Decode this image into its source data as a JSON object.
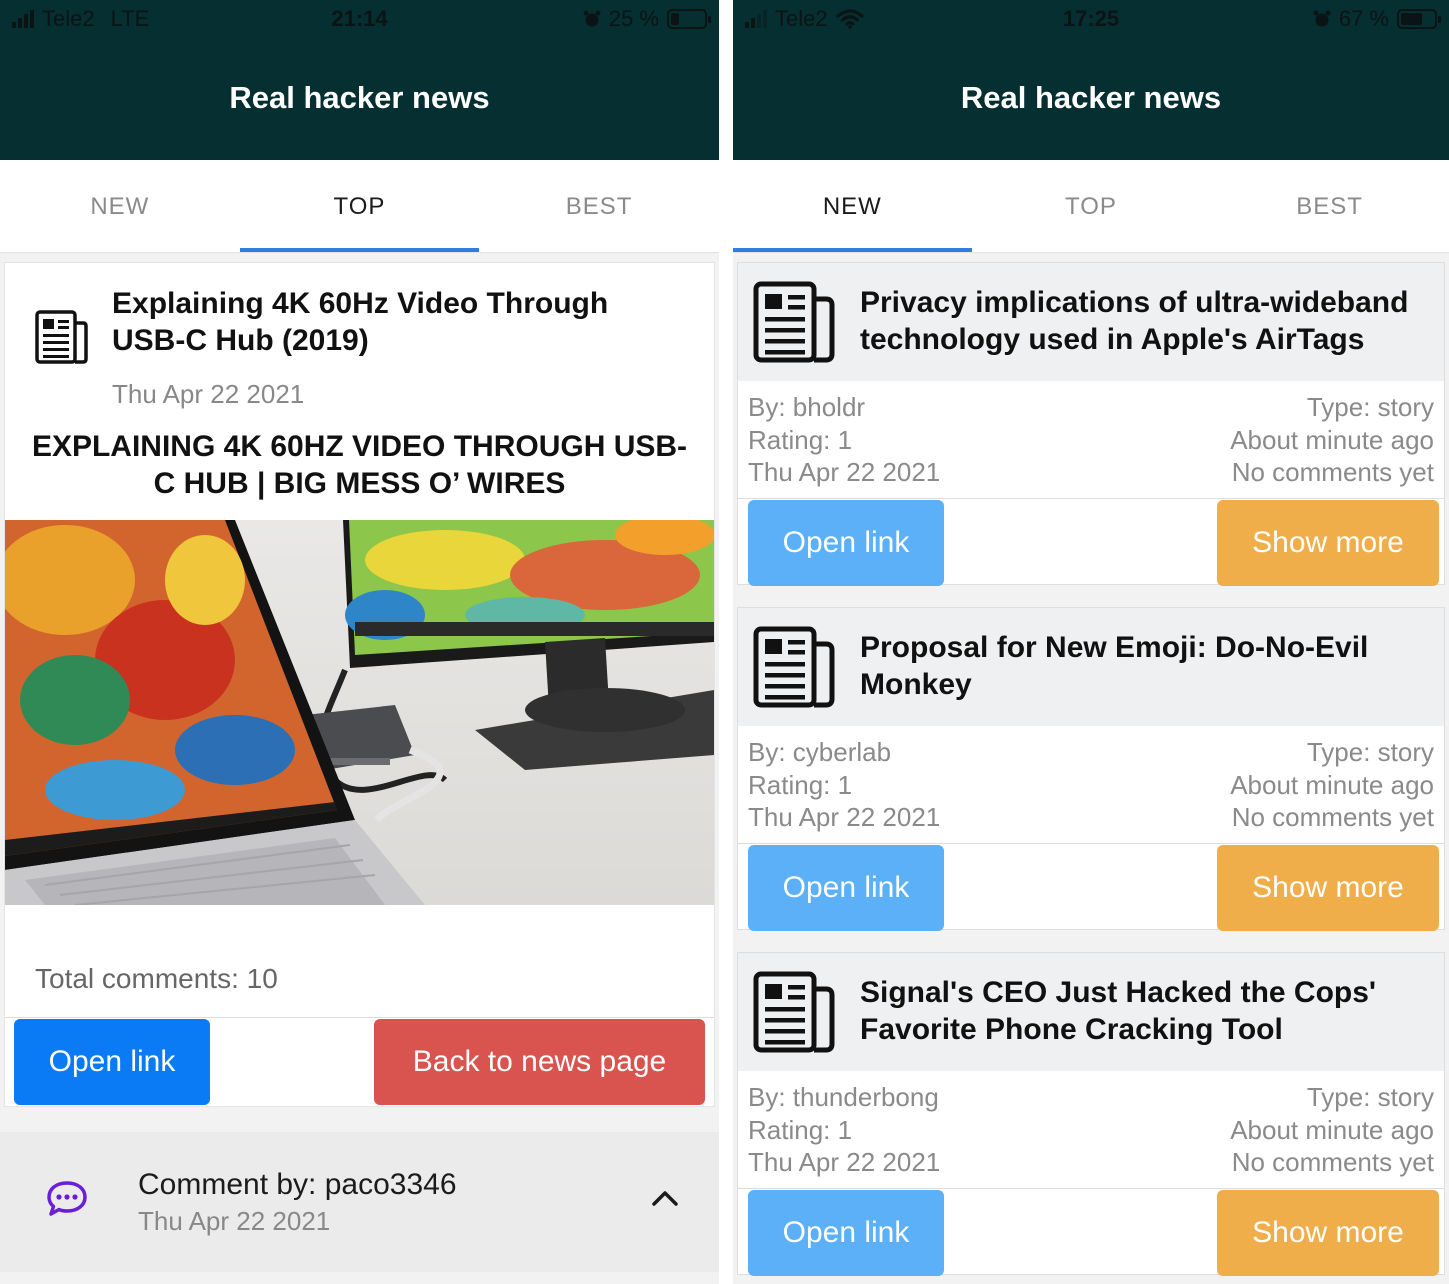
{
  "left_screen": {
    "status": {
      "carrier": "Tele2",
      "network": "LTE",
      "time": "21:14",
      "battery": "25 %",
      "battery_level": 0.25
    },
    "app_title": "Real hacker news",
    "tabs": [
      {
        "label": "NEW",
        "active": false
      },
      {
        "label": "TOP",
        "active": true
      },
      {
        "label": "BEST",
        "active": false
      }
    ],
    "story": {
      "title": "Explaining 4K 60Hz Video Through USB-C Hub (2019)",
      "date": "Thu Apr 22 2021",
      "article_heading": "EXPLAINING 4K 60HZ VIDEO THROUGH USB-C HUB | BIG MESS O’ WIRES",
      "total_comments": "Total comments: 10",
      "open_link_label": "Open link",
      "back_label": "Back to news page"
    },
    "comment": {
      "by": "Comment by: paco3346",
      "date": "Thu Apr 22 2021"
    }
  },
  "right_screen": {
    "status": {
      "carrier": "Tele2",
      "time": "17:25",
      "battery": "67 %",
      "battery_level": 0.67
    },
    "app_title": "Real hacker news",
    "tabs": [
      {
        "label": "NEW",
        "active": true
      },
      {
        "label": "TOP",
        "active": false
      },
      {
        "label": "BEST",
        "active": false
      }
    ],
    "stories": [
      {
        "title": "Privacy implications of ultra-wideband technology used in Apple's AirTags",
        "by": "By: bholdr",
        "rating": "Rating: 1",
        "date": "Thu Apr 22 2021",
        "type": "Type: story",
        "age": "About minute ago",
        "comments": "No comments yet",
        "open_label": "Open link",
        "more_label": "Show more"
      },
      {
        "title": "Proposal for New Emoji: Do-No-Evil Monkey",
        "by": "By: cyberlab",
        "rating": "Rating: 1",
        "date": "Thu Apr 22 2021",
        "type": "Type: story",
        "age": "About minute ago",
        "comments": "No comments yet",
        "open_label": "Open link",
        "more_label": "Show more"
      },
      {
        "title": "Signal's CEO Just Hacked the Cops' Favorite Phone Cracking Tool",
        "by": "By: thunderbong",
        "rating": "Rating: 1",
        "date": "Thu Apr 22 2021",
        "type": "Type: story",
        "age": "About minute ago",
        "comments": "No comments yet",
        "open_label": "Open link",
        "more_label": "Show more"
      }
    ]
  },
  "colors": {
    "header": "#062f31",
    "tab_indicator": "#2f7de1",
    "primary": "#0a7bf5",
    "danger": "#d9534f",
    "info": "#5bb0f8",
    "warning": "#efae4a",
    "comment_icon": "#6a1fd6"
  },
  "icons": {
    "story": "newspaper-icon",
    "comment": "chat-bubble-icon",
    "collapse": "chevron-up-icon",
    "wifi": "wifi-icon",
    "alarm": "alarm-icon"
  }
}
